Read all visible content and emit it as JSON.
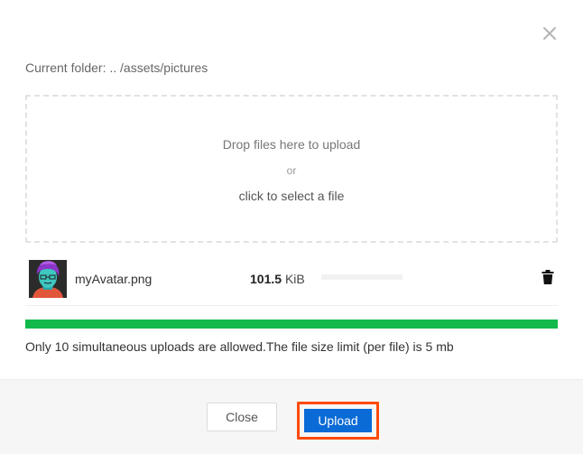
{
  "dialog": {
    "close_icon": "close-x-icon",
    "current_folder": "Current folder: .. /assets/pictures"
  },
  "dropzone": {
    "main_text": "Drop files here to upload",
    "or_text": "or",
    "click_text": "click to select a file"
  },
  "files": [
    {
      "name": "myAvatar.png",
      "size_value": "101.5",
      "size_unit": "KiB",
      "thumbnail_icon": "avatar-thumbnail",
      "progress": 0
    }
  ],
  "upload_progress": {
    "percent": 100,
    "color": "#13b94a"
  },
  "limit_note": "Only 10 simultaneous uploads are allowed.The file size limit (per file) is 5 mb",
  "footer": {
    "close_label": "Close",
    "upload_label": "Upload"
  },
  "colors": {
    "primary": "#0a6ad6",
    "highlight": "#ff4a0a",
    "success": "#13b94a"
  }
}
